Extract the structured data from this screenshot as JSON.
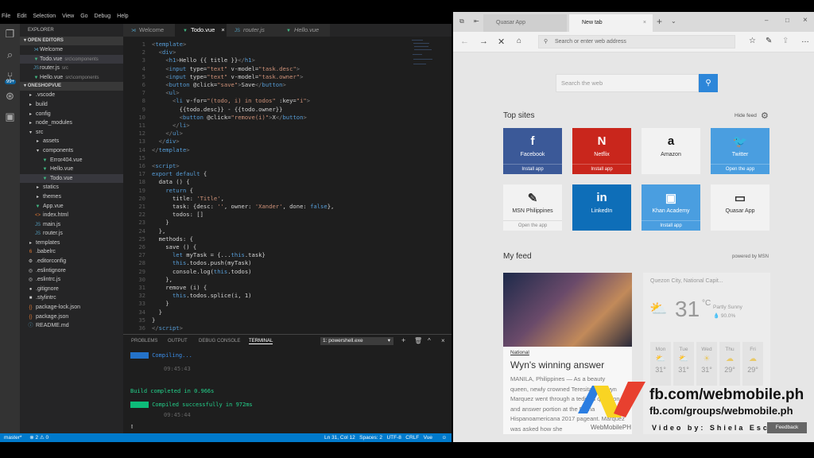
{
  "menu": [
    "File",
    "Edit",
    "Selection",
    "View",
    "Go",
    "Debug",
    "Help"
  ],
  "activity": {
    "badge": "99+"
  },
  "sidebar": {
    "title": "EXPLORER",
    "open_editors": "OPEN EDITORS",
    "project": "ONESHOPVUE",
    "open": [
      {
        "name": "Welcome",
        "sub": ""
      },
      {
        "name": "Todo.vue",
        "sub": "src\\components"
      },
      {
        "name": "router.js",
        "sub": "src"
      },
      {
        "name": "Hello.vue",
        "sub": "src\\components"
      }
    ],
    "tree": [
      {
        "name": ".vscode",
        "ic": "▸",
        "d": 1
      },
      {
        "name": "build",
        "ic": "▸",
        "d": 1
      },
      {
        "name": "config",
        "ic": "▸",
        "d": 1
      },
      {
        "name": "node_modules",
        "ic": "▸",
        "d": 1
      },
      {
        "name": "src",
        "ic": "▾",
        "d": 1
      },
      {
        "name": "assets",
        "ic": "▸",
        "d": 2
      },
      {
        "name": "components",
        "ic": "▾",
        "d": 2
      },
      {
        "name": "Error404.vue",
        "ic": "▼",
        "d": 3,
        "c": "vue"
      },
      {
        "name": "Hello.vue",
        "ic": "▼",
        "d": 3,
        "c": "vue"
      },
      {
        "name": "Todo.vue",
        "ic": "▼",
        "d": 3,
        "c": "vue",
        "sel": true
      },
      {
        "name": "statics",
        "ic": "▸",
        "d": 2
      },
      {
        "name": "themes",
        "ic": "▸",
        "d": 2
      },
      {
        "name": "App.vue",
        "ic": "▼",
        "d": 2,
        "c": "vue"
      },
      {
        "name": "index.html",
        "ic": "<>",
        "d": 2,
        "c": "html"
      },
      {
        "name": "main.js",
        "ic": "JS",
        "d": 2,
        "c": "js"
      },
      {
        "name": "router.js",
        "ic": "JS",
        "d": 2,
        "c": "js"
      },
      {
        "name": "templates",
        "ic": "▸",
        "d": 1
      },
      {
        "name": ".babelrc",
        "ic": "6",
        "d": 1,
        "c": "html"
      },
      {
        "name": ".editorconfig",
        "ic": "⚙",
        "d": 1
      },
      {
        "name": ".eslintignore",
        "ic": "◎",
        "d": 1
      },
      {
        "name": ".eslintrc.js",
        "ic": "◎",
        "d": 1
      },
      {
        "name": ".gitignore",
        "ic": "●",
        "d": 1
      },
      {
        "name": ".stylintrc",
        "ic": "■",
        "d": 1
      },
      {
        "name": "package-lock.json",
        "ic": "{}",
        "d": 1,
        "c": "html"
      },
      {
        "name": "package.json",
        "ic": "{}",
        "d": 1,
        "c": "html"
      },
      {
        "name": "README.md",
        "ic": "ⓘ",
        "d": 1,
        "c": "js"
      }
    ]
  },
  "tabs": [
    {
      "label": "Welcome"
    },
    {
      "label": "Todo.vue",
      "close": "×"
    },
    {
      "label": "router.js"
    },
    {
      "label": "Hello.vue"
    }
  ],
  "code": [
    "<template>",
    "  <div>",
    "    <h1>Hello {{ title }}</h1>",
    "    <input type=\"text\" v-model=\"task.desc\">",
    "    <input type=\"text\" v-model=\"task.owner\">",
    "    <button @click=\"save\">Save</button>",
    "    <ul>",
    "      <li v-for=\"(todo, i) in todos\" :key=\"i\">",
    "        {{todo.desc}} - {{todo.owner}}",
    "        <button @click=\"remove(i)\">X</button>",
    "      </li>",
    "    </ul>",
    "  </div>",
    "</template>",
    "",
    "<script>",
    "export default {",
    "  data () {",
    "    return {",
    "      title: 'Title',",
    "      task: {desc: '', owner: 'Xander', done: false},",
    "      todos: []",
    "    }",
    "  },",
    "  methods: {",
    "    save () {",
    "      let myTask = {...this.task}",
    "      this.todos.push(myTask)",
    "      console.log(this.todos)",
    "    },",
    "    remove (i) {",
    "      this.todos.splice(i, 1)",
    "    }",
    "  }",
    "}",
    "</script>"
  ],
  "panel": {
    "tabs": [
      "PROBLEMS",
      "OUTPUT",
      "DEBUG CONSOLE",
      "TERMINAL"
    ],
    "shell": "1: powershell.exe",
    "terminal": {
      "l1": "Compiling...",
      "t1": "09:45:43",
      "l2": "Build completed in 0.966s",
      "l3": "Compiled successfully in 972ms",
      "t2": "09:45:44"
    }
  },
  "status": {
    "branch": "master*",
    "problems": "⊗ 2 ⚠ 0",
    "right": "Ln 31, Col 12   Spaces: 2   UTF-8   CRLF   Vue"
  },
  "browser": {
    "tabs": [
      "Quasar App",
      "New tab"
    ],
    "address_placeholder": "Search or enter web address",
    "search_placeholder": "Search the web",
    "top_sites": "Top sites",
    "hide_feed": "Hide feed",
    "my_feed": "My feed",
    "powered": "powered by MSN",
    "sites": [
      {
        "name": "Facebook",
        "logo": "f",
        "sub": "Install app",
        "bg": "#3b5998"
      },
      {
        "name": "Netflix",
        "logo": "N",
        "sub": "Install app",
        "bg": "#c9261c"
      },
      {
        "name": "Amazon",
        "logo": "a",
        "sub": "",
        "bg": "light"
      },
      {
        "name": "Twitter",
        "logo": "🐦",
        "sub": "Open the app",
        "bg": "#4a9ee0"
      },
      {
        "name": "MSN Philippines",
        "logo": "✎",
        "sub": "Open the app",
        "bg": "light"
      },
      {
        "name": "LinkedIn",
        "logo": "in",
        "sub": "",
        "bg": "#0e6eb8"
      },
      {
        "name": "Khan Academy",
        "logo": "▣",
        "sub": "Install app",
        "bg": "#4a9ee0"
      },
      {
        "name": "Quasar App",
        "logo": "▭",
        "sub": "",
        "bg": "light"
      }
    ],
    "news": {
      "category": "National",
      "headline": "Wyn's winning answer",
      "body": "MANILA, Philippines — As a beauty queen, newly crowned Teresita \"Winwyn Marquez went through a tedious question and answer portion at the Reina Hispanoamericana 2017 pageant. Marquez was asked how she"
    },
    "weather": {
      "location": "Quezon City, National Capit...",
      "temp": "31",
      "unit": "°C",
      "cond": "Partly Sunny",
      "precip": "💧 90.0%",
      "days": [
        {
          "d": "Mon",
          "t": "31°"
        },
        {
          "d": "Tue",
          "t": "31°"
        },
        {
          "d": "Wed",
          "t": "31°"
        },
        {
          "d": "Thu",
          "t": "29°"
        },
        {
          "d": "Fri",
          "t": "29°"
        }
      ]
    },
    "feedback": "Feedback"
  },
  "watermark": {
    "l1": "fb.com/webmobile.ph",
    "l2": "fb.com/groups/webmobile.ph",
    "l3": "Video by: Shiela Esculta",
    "brand": "WebMobilePH"
  }
}
